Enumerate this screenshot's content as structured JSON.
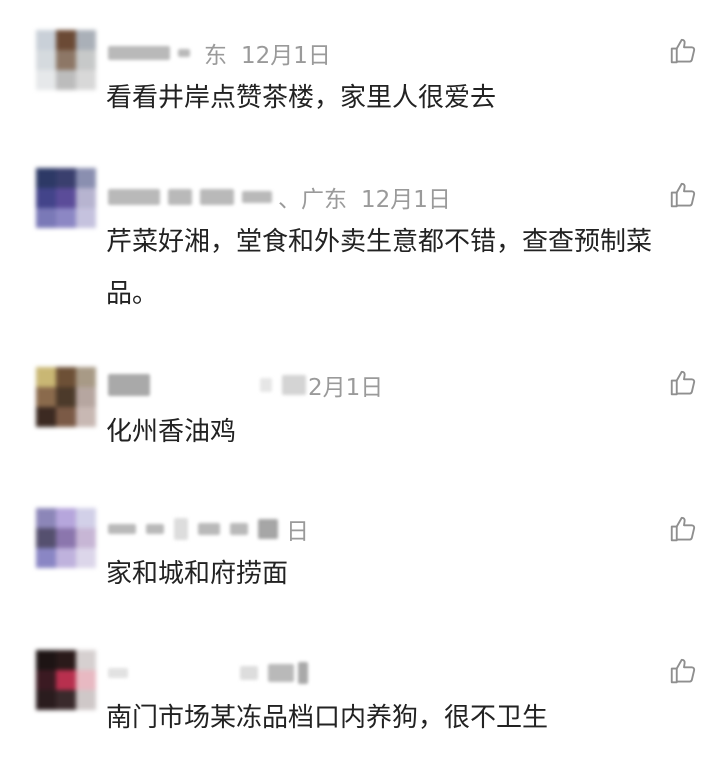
{
  "comments": [
    {
      "location": "广东",
      "location_visible": "东",
      "date": "12月1日",
      "text": "看看井岸点赞茶楼，家里人很爱去",
      "like_icon": "thumbs-up-outline-icon",
      "avatar_colors": [
        "#c9d0d8",
        "#6b4a35",
        "#aab0b8",
        "#d5dade",
        "#8d7766",
        "#c7c9c9",
        "#e6e8ea",
        "#bcbcbc",
        "#d8d8d8"
      ]
    },
    {
      "location": "广东",
      "location_visible": "、广东",
      "date": "12月1日",
      "text": "芹菜好湘，堂食和外卖生意都不错，查查预制菜品。",
      "like_icon": "thumbs-up-outline-icon",
      "avatar_colors": [
        "#2d3966",
        "#3a3f6e",
        "#8a8fb0",
        "#43448a",
        "#5b4c99",
        "#b7b4d0",
        "#7a79b7",
        "#8c87c4",
        "#c5c2de"
      ]
    },
    {
      "location": "",
      "location_visible": "",
      "date": "12月1日",
      "date_visible": "2月1日",
      "text": "化州香油鸡",
      "like_icon": "thumbs-up-outline-icon",
      "avatar_colors": [
        "#c9b774",
        "#6d5036",
        "#a89a86",
        "#8a6a4c",
        "#4c3a2a",
        "#b6a6a0",
        "#3c2a22",
        "#7b5a46",
        "#c8b8b3"
      ]
    },
    {
      "location": "",
      "location_visible": "",
      "date": "12月1日",
      "date_visible": "日",
      "text": "家和城和府捞面",
      "like_icon": "thumbs-up-outline-icon",
      "avatar_colors": [
        "#8c86b8",
        "#b6a6dc",
        "#d2d0e8",
        "#55506f",
        "#8b76ad",
        "#c7b6d5",
        "#8a86c4",
        "#bfb2dd",
        "#dcd6ea"
      ]
    },
    {
      "location": "",
      "location_visible": "",
      "date": "",
      "text": "南门市场某冻品档口内养狗，很不卫生",
      "like_icon": "thumbs-up-outline-icon",
      "avatar_colors": [
        "#1d1414",
        "#2a1a1a",
        "#d6d0d0",
        "#3b1a22",
        "#b8304e",
        "#e8b9c2",
        "#2a1c1e",
        "#3a2a2c",
        "#cfc8c8"
      ]
    }
  ]
}
